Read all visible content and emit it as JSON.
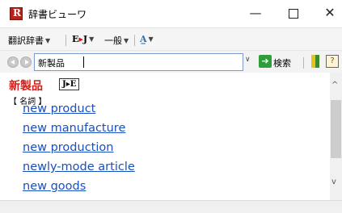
{
  "window": {
    "title": "辞書ビューワ",
    "minimize": "—",
    "close": "✕"
  },
  "toolbar": {
    "dict_label": "翻訳辞書",
    "ej_prefix": "E",
    "ej_arrow": "▸",
    "ej_suffix": "J",
    "general_label": "一般",
    "font_icon": "A̲"
  },
  "search": {
    "value": "新製品",
    "button_label": "検索"
  },
  "entry": {
    "headword": "新製品",
    "badge": "J▸E",
    "pos": "【 名詞 】",
    "meanings": [
      "new product",
      "new manufacture",
      "new production",
      "newly-mode article",
      "new goods"
    ]
  },
  "icons": {
    "app": "dictionary-app-icon",
    "back": "back-arrow-icon",
    "forward": "forward-arrow-icon",
    "go": "go-arrow-icon",
    "bookmark": "bookmark-icon",
    "help": "help-icon"
  }
}
